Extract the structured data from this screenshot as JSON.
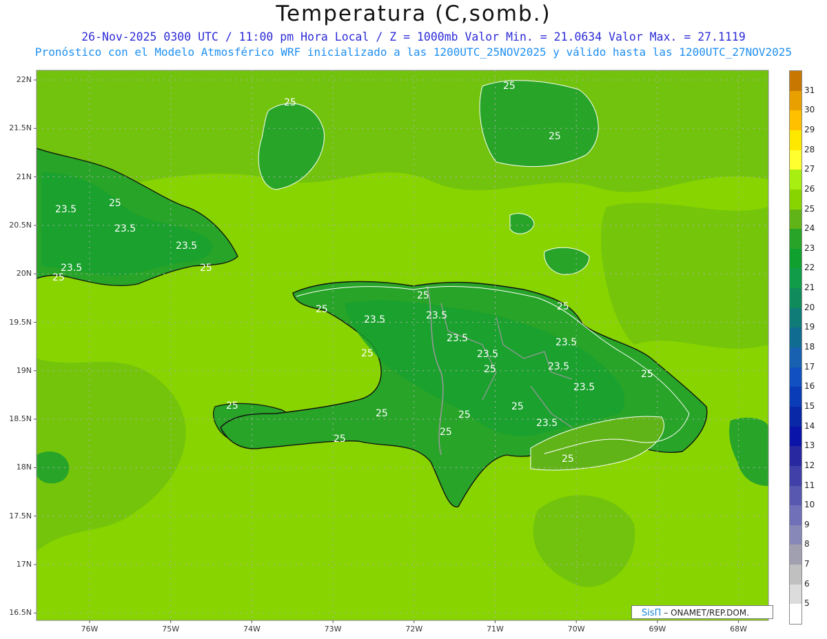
{
  "header": {
    "title": "Temperatura (C,somb.)",
    "line1": "26-Nov-2025 0300 UTC / 11:00 pm Hora Local / Z = 1000mb  Valor Min. = 21.0634  Valor Max. = 27.1119",
    "line2": "Pronóstico con el Modelo Atmosférico WRF inicializado a las 1200UTC_25NOV2025 y válido hasta las  1200UTC_27NOV2025"
  },
  "map": {
    "lat_ticks": [
      "22N",
      "21.5N",
      "21N",
      "20.5N",
      "20N",
      "19.5N",
      "19N",
      "18.5N",
      "18N",
      "17.5N",
      "17N",
      "16.5N"
    ],
    "lon_ticks": [
      "76W",
      "75W",
      "74W",
      "73W",
      "72W",
      "71W",
      "70W",
      "69W",
      "68W"
    ],
    "contour_labels": [
      "25",
      "23.5"
    ],
    "colors": {
      "ocean_warm": "#88d400",
      "land_mid": "#3aa61c",
      "sea_mid": "#60b418",
      "land_cool": "#16a030",
      "coast": "#111111",
      "border": "#999999",
      "contour": "#ffffff"
    }
  },
  "colorbar": {
    "labels": [
      "31",
      "30",
      "29",
      "28",
      "27",
      "26",
      "25",
      "24",
      "23",
      "22",
      "21",
      "20",
      "19",
      "18",
      "17",
      "16",
      "15",
      "14",
      "13",
      "12",
      "11",
      "10",
      "9",
      "8",
      "7",
      "6",
      "5"
    ],
    "colors": [
      "#c87800",
      "#e8a000",
      "#ffc000",
      "#ffe800",
      "#ffff30",
      "#a8ee10",
      "#88d400",
      "#60b418",
      "#28a428",
      "#10a030",
      "#109c48",
      "#108c5c",
      "#107c78",
      "#106c90",
      "#1860b0",
      "#1050c0",
      "#0a3cb8",
      "#0828a8",
      "#0a14a8",
      "#2828a0",
      "#4040a8",
      "#5858b0",
      "#7070b8",
      "#8888b8",
      "#a0a0b0",
      "#c0c0c0",
      "#dcdcdc",
      "#ffffff"
    ]
  },
  "footer": {
    "logo": "SisΠ",
    "org": "– ONAMET/REP.DOM."
  }
}
